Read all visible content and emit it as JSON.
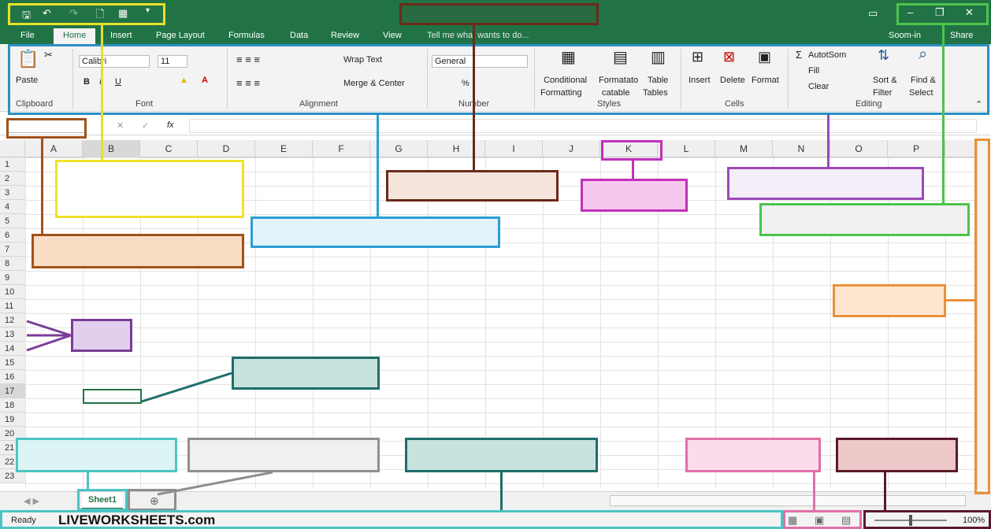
{
  "title_bar": {
    "quick_access": [
      "save",
      "undo",
      "redo",
      "new",
      "print",
      "customize"
    ],
    "window_controls": [
      "ribbon-display",
      "minimize",
      "restore",
      "close"
    ]
  },
  "menu": {
    "file": "File",
    "home": "Home",
    "insert": "Insert",
    "page_layout": "Page Layout",
    "formulas": "Formulas",
    "data": "Data",
    "review": "Review",
    "view": "View",
    "tell_me": "Tell me what wants to do...",
    "sign_in": "Soom-in",
    "share": "Share"
  },
  "ribbon": {
    "clipboard": {
      "paste": "Paste",
      "label": "Clipboard"
    },
    "font": {
      "name": "Calibri",
      "size": "11",
      "bold": "B",
      "italic": "I",
      "underline": "U",
      "label": "Font"
    },
    "alignment": {
      "wrap": "Wrap Text",
      "merge": "Merge & Center",
      "label": "Alignment"
    },
    "number": {
      "format": "General",
      "percent": "%",
      "label": "Number"
    },
    "styles": {
      "conditional": "Conditional",
      "formatting": "Formatting",
      "format_as": "Formatato",
      "catable": "catable",
      "table": "Table",
      "tables": "Tables",
      "label": "Styles"
    },
    "cells": {
      "insert": "Insert",
      "delete": "Delete",
      "format": "Format",
      "label": "Cells"
    },
    "editing": {
      "autosum": "AutotSom",
      "fill": "Fill",
      "clear": "Clear",
      "sort": "Sort &",
      "filter": "Filter",
      "find": "Find &",
      "select": "Select",
      "label": "Editing"
    }
  },
  "formula_bar": {
    "cancel": "✕",
    "enter": "✓",
    "fx": "fx"
  },
  "columns": [
    "A",
    "B",
    "C",
    "D",
    "E",
    "F",
    "G",
    "H",
    "I",
    "J",
    "K",
    "L",
    "M",
    "N",
    "O",
    "P"
  ],
  "rows": [
    "1",
    "2",
    "3",
    "4",
    "5",
    "6",
    "7",
    "8",
    "9",
    "10",
    "11",
    "12",
    "13",
    "14",
    "15",
    "16",
    "17",
    "18",
    "19",
    "20",
    "21",
    "22",
    "23"
  ],
  "sheet_tabs": {
    "sheet1": "Sheet1",
    "add": "⊕"
  },
  "status_bar": {
    "ready": "Ready",
    "watermark": "LIVEWORKSHEETS.com",
    "zoom": "100%"
  },
  "colors": {
    "excel_green": "#217346",
    "ribbon_bg": "#f3f3f3"
  }
}
